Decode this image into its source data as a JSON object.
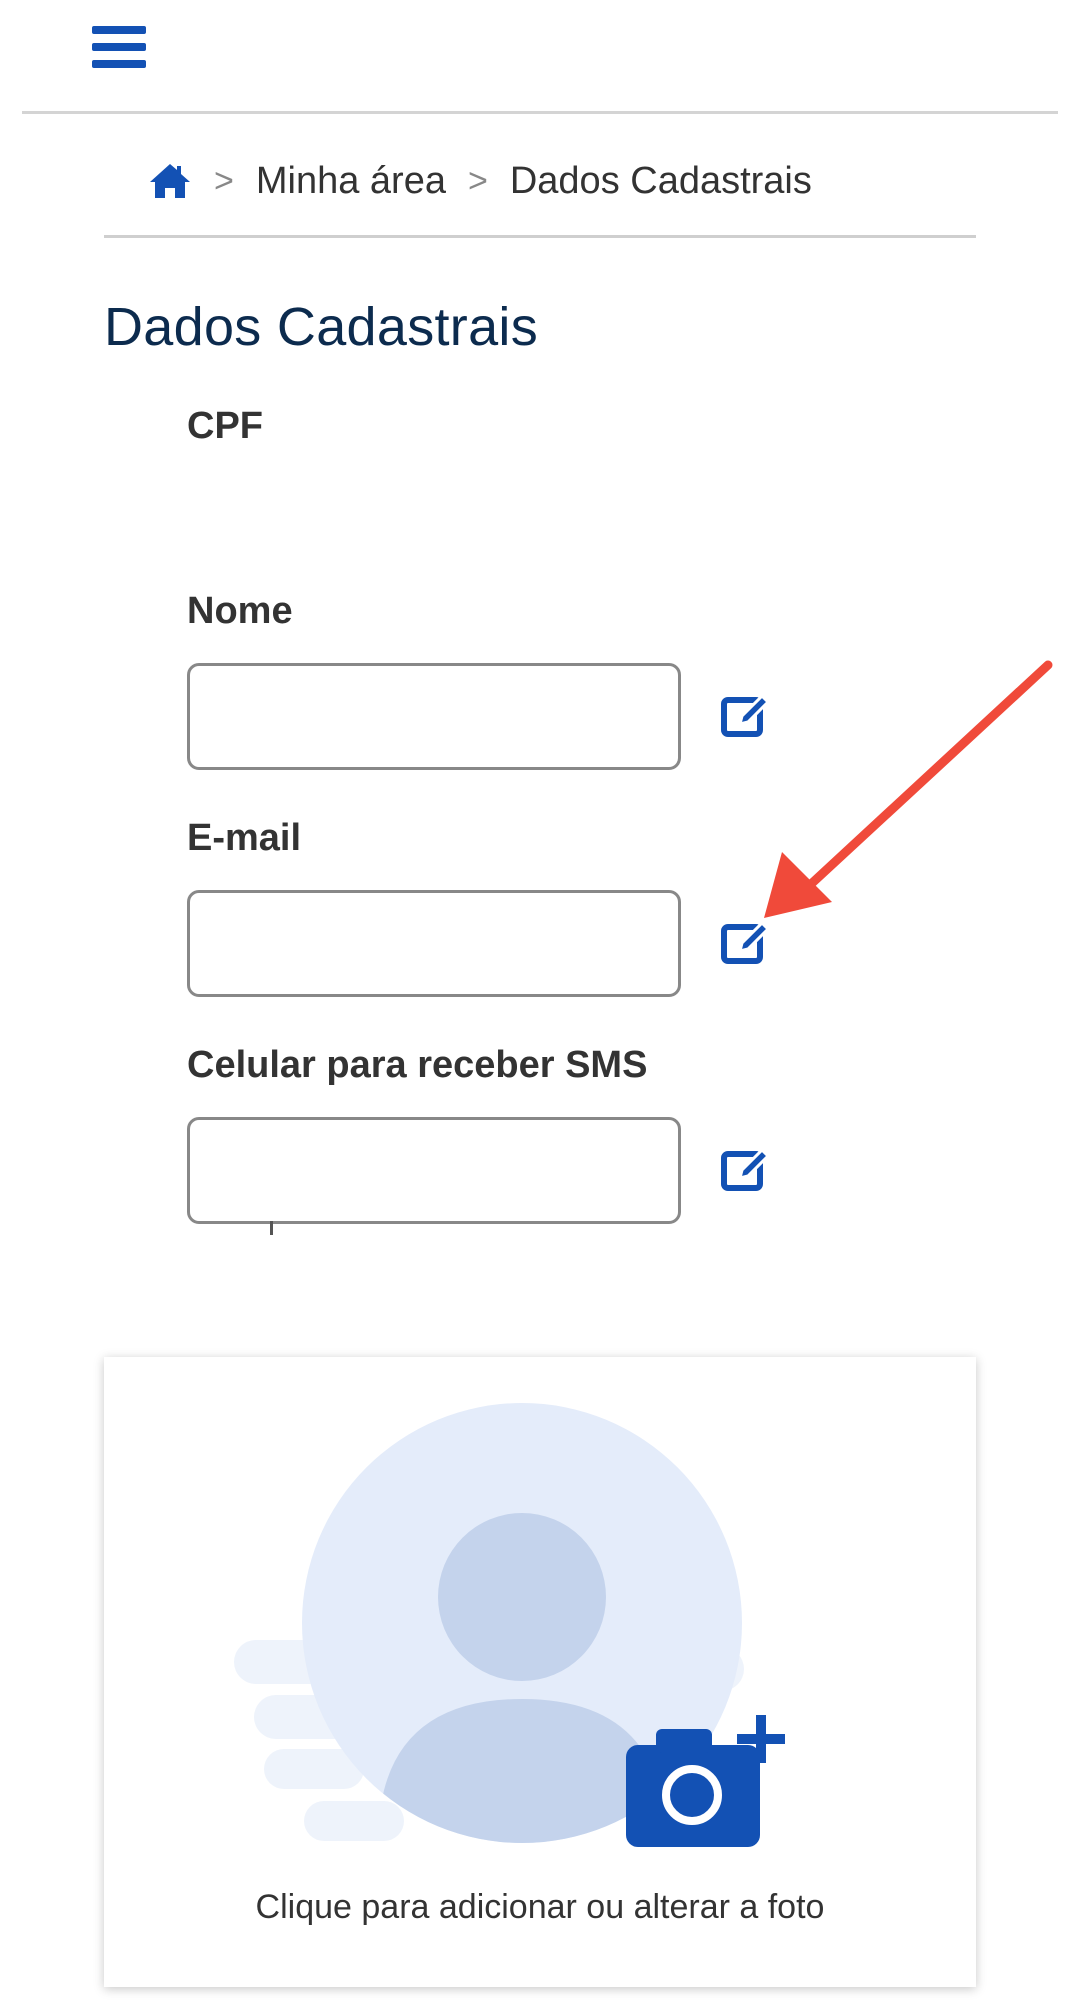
{
  "header": {
    "menu_icon": "hamburger-menu-icon"
  },
  "breadcrumb": {
    "home_icon": "home-icon",
    "separator": ">",
    "items": [
      "Minha área",
      "Dados Cadastrais"
    ]
  },
  "page": {
    "title": "Dados Cadastrais"
  },
  "form": {
    "cpf_label": "CPF",
    "fields": [
      {
        "label": "Nome",
        "value": "",
        "edit_icon": "edit-icon"
      },
      {
        "label": "E-mail",
        "value": "",
        "edit_icon": "edit-icon"
      },
      {
        "label": "Celular para receber SMS",
        "value": "",
        "edit_icon": "edit-icon"
      }
    ]
  },
  "photo": {
    "caption": "Clique para adicionar ou alterar a foto",
    "avatar_icon": "user-avatar-icon",
    "camera_icon": "camera-plus-icon"
  },
  "colors": {
    "brand_blue": "#1351b4",
    "title_blue": "#0c2b4e",
    "annotation_red": "#f04a3a",
    "avatar_light": "#e4ecfa",
    "avatar_mid": "#c4d3ec"
  }
}
